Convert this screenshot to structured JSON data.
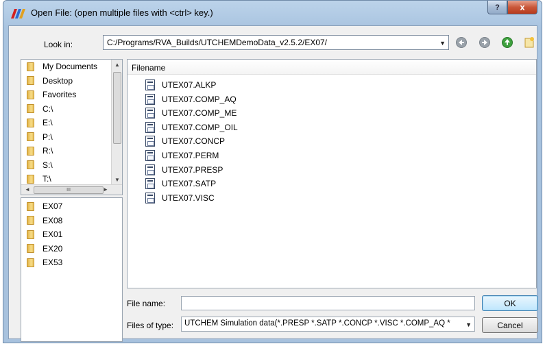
{
  "window": {
    "title": "Open File:  (open multiple files with <ctrl> key.)",
    "help_glyph": "?",
    "close_glyph": "x"
  },
  "lookin": {
    "label": "Look in:",
    "path": "C:/Programs/RVA_Builds/UTCHEMDemoData_v2.5.2/EX07/"
  },
  "places": [
    "My Documents",
    "Desktop",
    "Favorites",
    "C:\\",
    "E:\\",
    "P:\\",
    "R:\\",
    "S:\\",
    "T:\\"
  ],
  "recent": [
    "EX07",
    "EX08",
    "EX01",
    "EX20",
    "EX53"
  ],
  "files": {
    "header": "Filename",
    "items": [
      "UTEX07.ALKP",
      "UTEX07.COMP_AQ",
      "UTEX07.COMP_ME",
      "UTEX07.COMP_OIL",
      "UTEX07.CONCP",
      "UTEX07.PERM",
      "UTEX07.PRESP",
      "UTEX07.SATP",
      "UTEX07.VISC"
    ]
  },
  "form": {
    "filename_label": "File name:",
    "filename_value": "",
    "filetype_label": "Files of type:",
    "filetype_value": "UTCHEM Simulation data(*.PRESP *.SATP *.CONCP *.VISC *.COMP_AQ *"
  },
  "buttons": {
    "ok": "OK",
    "cancel": "Cancel"
  },
  "colors": {
    "accent": "#3c7fb1",
    "close": "#c9583a"
  }
}
